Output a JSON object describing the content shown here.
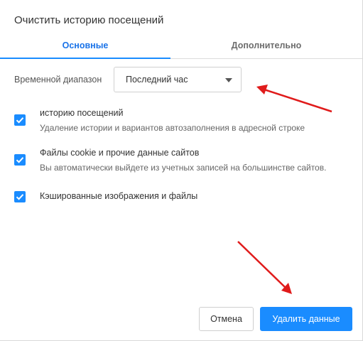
{
  "dialog": {
    "title": "Очистить историю посещений"
  },
  "tabs": [
    {
      "label": "Основные",
      "active": true
    },
    {
      "label": "Дополнительно",
      "active": false
    }
  ],
  "time_range": {
    "label": "Временной диапазон",
    "selected": "Последний час"
  },
  "options": [
    {
      "title": "историю посещений",
      "description": "Удаление истории и вариантов автозаполнения в адресной строке",
      "checked": true
    },
    {
      "title": "Файлы cookie и прочие данные сайтов",
      "description": "Вы автоматически выйдете из учетных записей на большинстве сайтов.",
      "checked": true
    },
    {
      "title": "Кэшированные изображения и файлы",
      "description": "",
      "checked": true
    }
  ],
  "buttons": {
    "cancel": "Отмена",
    "delete": "Удалить данные"
  },
  "colors": {
    "accent": "#1a8cff",
    "annotation_arrow": "#e01b1b"
  },
  "icons": {
    "checkbox": "checkmark-icon",
    "dropdown": "caret-down-icon"
  }
}
